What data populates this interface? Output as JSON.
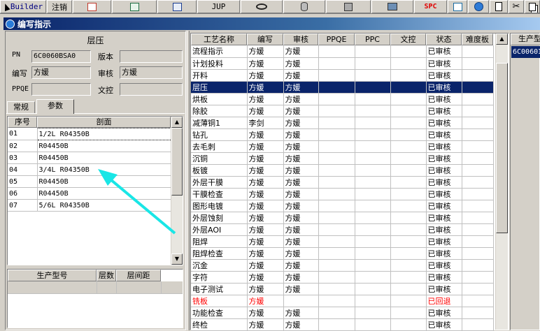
{
  "toolbar": {
    "builder_label": "Builder",
    "logout_label": "注销",
    "jup_label": "JUP",
    "spc_label": "SPC"
  },
  "window": {
    "title": "编写指示"
  },
  "left": {
    "section_title": "层压",
    "pn_label": "PN",
    "pn_value": "6C0060BSA0",
    "version_label": "版本",
    "version_value": "",
    "writer_label": "编写",
    "writer_value": "方媛",
    "reviewer_label": "审核",
    "reviewer_value": "方媛",
    "ppqe_label": "PPQE",
    "ppqe_value": "",
    "doc_control_label": "文控",
    "doc_control_value": "",
    "tabs": [
      "常规",
      "参数"
    ],
    "param_table": {
      "headers": [
        "序号",
        "剖面"
      ],
      "rows": [
        [
          "01",
          "1/2L R04350B"
        ],
        [
          "02",
          "R04450B"
        ],
        [
          "03",
          "R04450B"
        ],
        [
          "04",
          "3/4L R04350B"
        ],
        [
          "05",
          "R04450B"
        ],
        [
          "06",
          "R04450B"
        ],
        [
          "07",
          "5/6L R04350B"
        ]
      ]
    },
    "model_table": {
      "headers": [
        "生产型号",
        "层数",
        "层间距"
      ]
    }
  },
  "main": {
    "headers": [
      "工艺名称",
      "编写",
      "审核",
      "PPQE",
      "PPC",
      "文控",
      "状态",
      "难度板"
    ],
    "rows": [
      [
        "流程指示",
        "方媛",
        "方媛",
        "",
        "",
        "",
        "已审核",
        ""
      ],
      [
        "计划投料",
        "方媛",
        "方媛",
        "",
        "",
        "",
        "已审核",
        ""
      ],
      [
        "开料",
        "方媛",
        "方媛",
        "",
        "",
        "",
        "已审核",
        ""
      ],
      [
        "层压",
        "方媛",
        "方媛",
        "",
        "",
        "",
        "已审核",
        ""
      ],
      [
        "烘板",
        "方媛",
        "方媛",
        "",
        "",
        "",
        "已审核",
        ""
      ],
      [
        "除胶",
        "方媛",
        "方媛",
        "",
        "",
        "",
        "已审核",
        ""
      ],
      [
        "减薄铜1",
        "李剑",
        "方媛",
        "",
        "",
        "",
        "已审核",
        ""
      ],
      [
        "钻孔",
        "方媛",
        "方媛",
        "",
        "",
        "",
        "已审核",
        ""
      ],
      [
        "去毛刺",
        "方媛",
        "方媛",
        "",
        "",
        "",
        "已审核",
        ""
      ],
      [
        "沉铜",
        "方媛",
        "方媛",
        "",
        "",
        "",
        "已审核",
        ""
      ],
      [
        "板镀",
        "方媛",
        "方媛",
        "",
        "",
        "",
        "已审核",
        ""
      ],
      [
        "外层干膜",
        "方媛",
        "方媛",
        "",
        "",
        "",
        "已审核",
        ""
      ],
      [
        "干膜检查",
        "方媛",
        "方媛",
        "",
        "",
        "",
        "已审核",
        ""
      ],
      [
        "图形电镀",
        "方媛",
        "方媛",
        "",
        "",
        "",
        "已审核",
        ""
      ],
      [
        "外层蚀刻",
        "方媛",
        "方媛",
        "",
        "",
        "",
        "已审核",
        ""
      ],
      [
        "外层AOI",
        "方媛",
        "方媛",
        "",
        "",
        "",
        "已审核",
        ""
      ],
      [
        "阻焊",
        "方媛",
        "方媛",
        "",
        "",
        "",
        "已审核",
        ""
      ],
      [
        "阻焊检查",
        "方媛",
        "方媛",
        "",
        "",
        "",
        "已审核",
        ""
      ],
      [
        "沉金",
        "方媛",
        "方媛",
        "",
        "",
        "",
        "已审核",
        ""
      ],
      [
        "字符",
        "方媛",
        "方媛",
        "",
        "",
        "",
        "已审核",
        ""
      ],
      [
        "电子测试",
        "方媛",
        "方媛",
        "",
        "",
        "",
        "已审核",
        ""
      ],
      [
        "铣板",
        "方媛",
        "",
        "",
        "",
        "",
        "已回退",
        ""
      ],
      [
        "功能检查",
        "方媛",
        "方媛",
        "",
        "",
        "",
        "已审核",
        ""
      ],
      [
        "终检",
        "方媛",
        "方媛",
        "",
        "",
        "",
        "已审核",
        ""
      ]
    ],
    "selected_row": 3,
    "red_row": 21
  },
  "right": {
    "header": "生产型",
    "value": "6C0060I"
  },
  "colors": {
    "selection": "#0a246a",
    "warning": "#ff0000",
    "arrow": "#19e6e6"
  }
}
